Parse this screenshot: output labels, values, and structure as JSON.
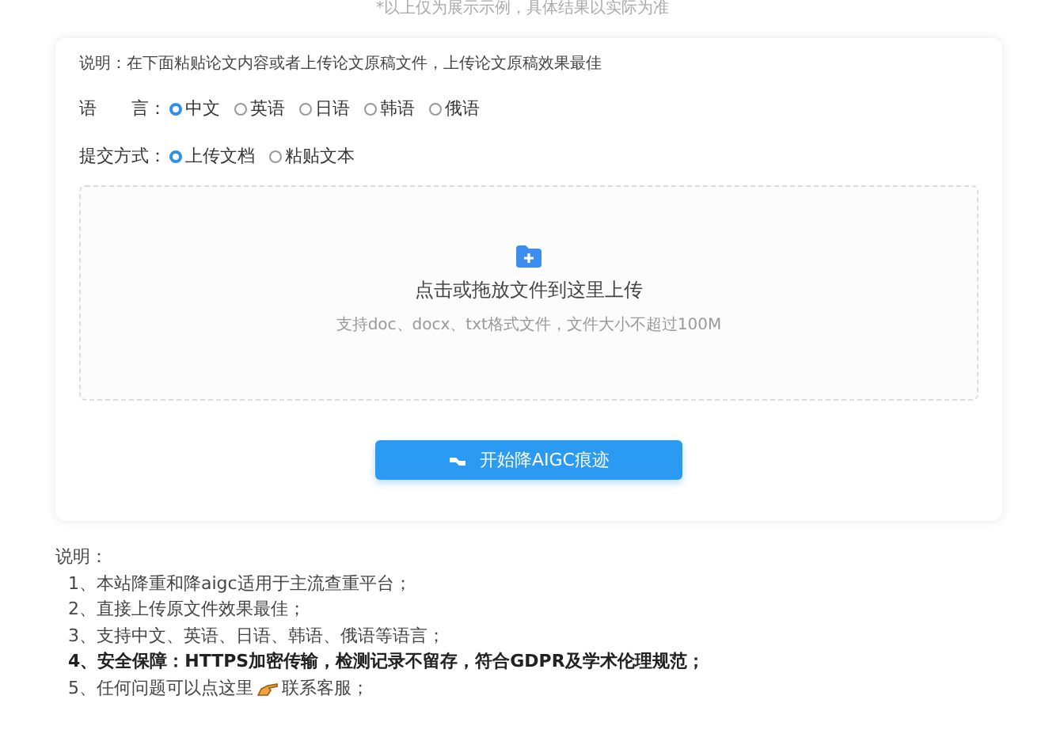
{
  "caption": "*以上仅为展示示例，具体结果以实际为准",
  "card": {
    "hint": "说明：在下面粘贴论文内容或者上传论文原稿文件，上传论文原稿效果最佳",
    "language": {
      "label": "语　　言：",
      "options": [
        {
          "label": "中文",
          "selected": true
        },
        {
          "label": "英语",
          "selected": false
        },
        {
          "label": "日语",
          "selected": false
        },
        {
          "label": "韩语",
          "selected": false
        },
        {
          "label": "俄语",
          "selected": false
        }
      ]
    },
    "mode": {
      "label": "提交方式：",
      "options": [
        {
          "label": "上传文档",
          "selected": true
        },
        {
          "label": "粘贴文本",
          "selected": false
        }
      ]
    },
    "upload": {
      "title": "点击或拖放文件到这里上传",
      "subtitle": "支持doc、docx、txt格式文件，文件大小不超过100M"
    },
    "button": "开始降AIGC痕迹"
  },
  "notes": {
    "title": "说明：",
    "items": [
      {
        "kind": "plain",
        "text": "1、本站降重和降aigc适用于主流查重平台；"
      },
      {
        "kind": "plain",
        "text": "2、直接上传原文件效果最佳；"
      },
      {
        "kind": "plain",
        "text": "3、支持中文、英语、日语、韩语、俄语等语言；"
      },
      {
        "kind": "bold",
        "text": "4、安全保障：HTTPS加密传输，检测记录不留存，符合GDPR及学术伦理规范；"
      },
      {
        "kind": "link",
        "text": "5、任何问题可以点这里",
        "after": "联系客服；"
      }
    ]
  }
}
